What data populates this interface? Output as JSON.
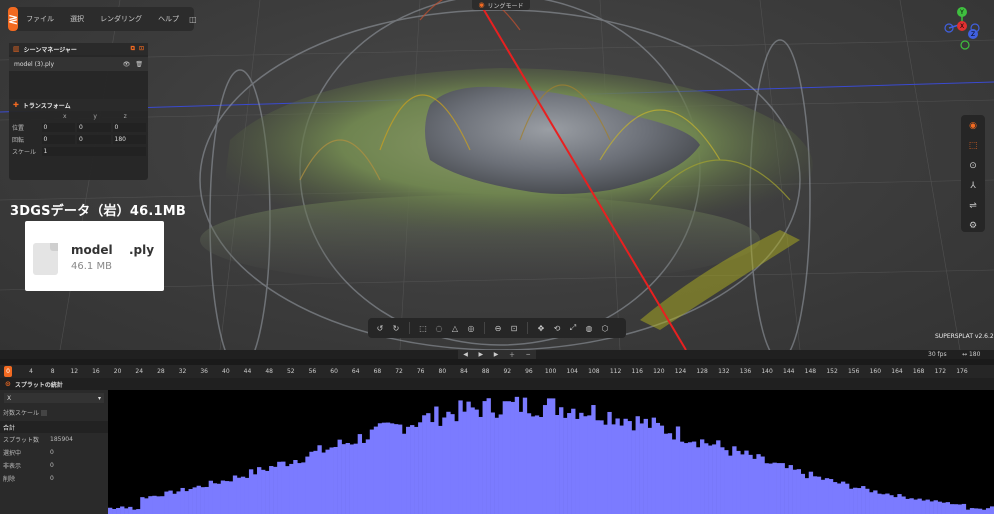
{
  "menubar": {
    "items": [
      "ファイル",
      "選択",
      "レンダリング",
      "ヘルプ"
    ],
    "icon": "panel-icon"
  },
  "ring_mode": {
    "label": "リングモード"
  },
  "scene_manager": {
    "title": "シーンマネージャー",
    "model_name": "model (3).ply",
    "transform_title": "トランスフォーム",
    "axes": [
      "x",
      "y",
      "z"
    ],
    "rows": [
      {
        "label": "位置",
        "values": [
          "0",
          "0",
          "0"
        ]
      },
      {
        "label": "回転",
        "values": [
          "0",
          "0",
          "180"
        ]
      }
    ],
    "scale_label": "スケール",
    "scale_value": "1"
  },
  "caption": "3DGSデータ（岩）46.1MB",
  "file_card": {
    "name": "model",
    "ext": ".ply",
    "size": "46.1 MB"
  },
  "gizmo": {
    "x": "X",
    "y": "Y",
    "z": "Z"
  },
  "version": "SUPERSPLAT v2.6.2",
  "timeline": {
    "fps": "30 fps",
    "end_frame": "180",
    "current": "0",
    "ticks": [
      "4",
      "8",
      "12",
      "16",
      "20",
      "24",
      "28",
      "32",
      "36",
      "40",
      "44",
      "48",
      "52",
      "56",
      "60",
      "64",
      "68",
      "72",
      "76",
      "80",
      "84",
      "88",
      "92",
      "96",
      "100",
      "104",
      "108",
      "112",
      "116",
      "120",
      "124",
      "128",
      "132",
      "136",
      "140",
      "144",
      "148",
      "152",
      "156",
      "160",
      "164",
      "168",
      "172",
      "176"
    ]
  },
  "stats": {
    "title": "スプラットの統計",
    "property": "X",
    "log_scale_label": "対数スケール",
    "section_label": "合計",
    "rows": [
      {
        "label": "スプラット数",
        "value": "185904"
      },
      {
        "label": "選択中",
        "value": "0"
      },
      {
        "label": "非表示",
        "value": "0"
      },
      {
        "label": "削除",
        "value": "0"
      }
    ]
  },
  "colors": {
    "accent": "#f26a21",
    "histogram": "#7b7bff"
  }
}
